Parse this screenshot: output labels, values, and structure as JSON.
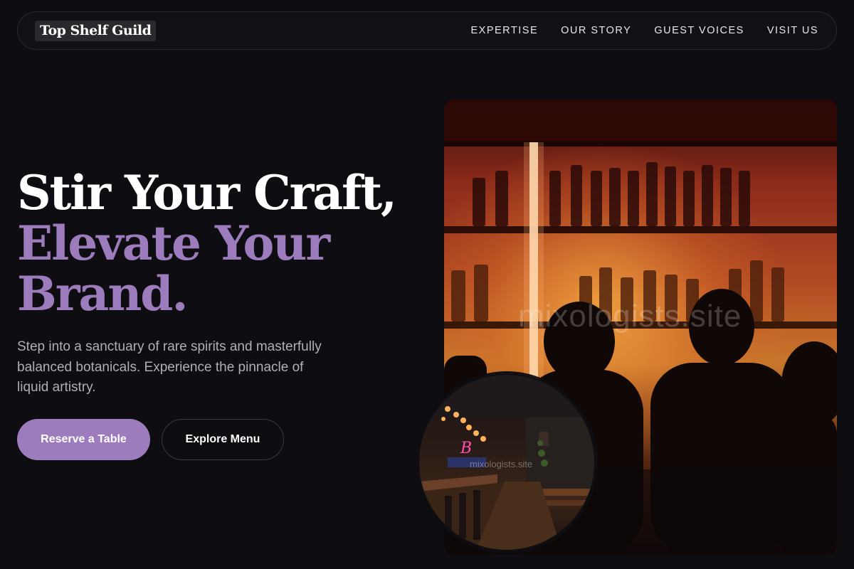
{
  "brand": {
    "name": "Top Shelf Guild"
  },
  "nav": {
    "links": [
      {
        "label": "EXPERTISE"
      },
      {
        "label": "OUR STORY"
      },
      {
        "label": "GUEST VOICES"
      },
      {
        "label": "VISIT US"
      }
    ]
  },
  "hero": {
    "title_line1": "Stir Your Craft,",
    "title_line2": "Elevate Your",
    "title_line3": "Brand.",
    "description": "Step into a sanctuary of rare spirits and masterfully balanced botanicals. Experience the pinnacle of liquid artistry.",
    "primary_button": "Reserve a Table",
    "secondary_button": "Explore Menu"
  },
  "images": {
    "main_watermark": "mixologists.site",
    "circle_watermark": "mixologists.site"
  },
  "colors": {
    "background": "#0e0d12",
    "accent": "#9d7cbd",
    "text_muted": "#b0aeb7"
  }
}
